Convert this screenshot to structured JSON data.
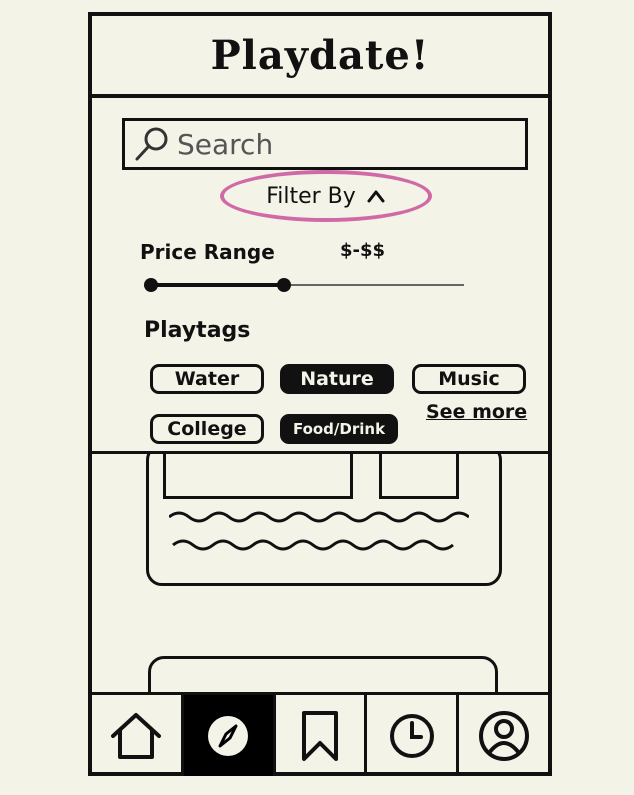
{
  "app": {
    "title": "Playdate!"
  },
  "search": {
    "placeholder": "Search",
    "icon": "search-icon"
  },
  "filter": {
    "label": "Filter By",
    "icon": "chevron-up-icon",
    "highlight_color": "#d06aa6"
  },
  "price_range": {
    "label": "Price Range",
    "value": "$-$$",
    "selected_fraction": 0.43
  },
  "playtags": {
    "label": "Playtags",
    "tags": [
      {
        "label": "Water",
        "selected": false
      },
      {
        "label": "Nature",
        "selected": true
      },
      {
        "label": "Music",
        "selected": false
      },
      {
        "label": "College",
        "selected": false
      },
      {
        "label": "Food/Drink",
        "selected": true
      }
    ],
    "see_more": "See more"
  },
  "nav": {
    "items": [
      {
        "icon": "home-icon",
        "active": false
      },
      {
        "icon": "compass-icon",
        "active": true
      },
      {
        "icon": "bookmark-icon",
        "active": false
      },
      {
        "icon": "clock-icon",
        "active": false
      },
      {
        "icon": "profile-icon",
        "active": false
      }
    ]
  },
  "colors": {
    "background": "#f4f3e8",
    "ink": "#111111",
    "accent": "#d06aa6"
  }
}
